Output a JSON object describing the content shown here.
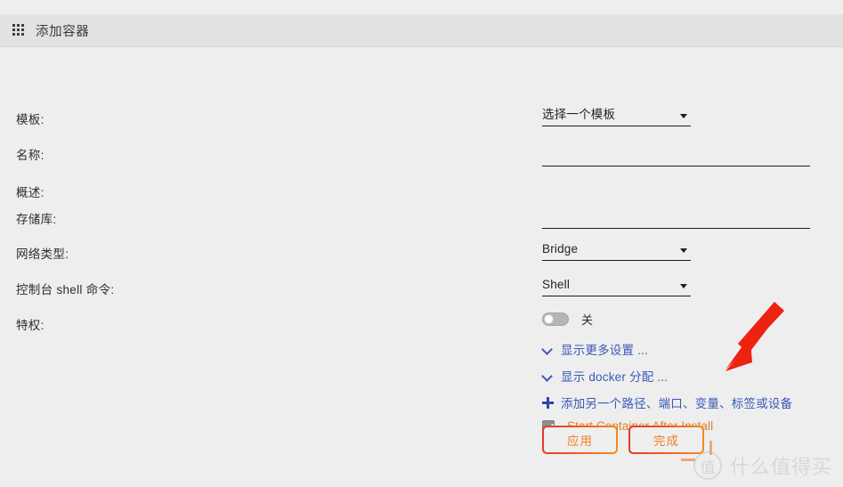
{
  "header": {
    "icon": "grid-apps-icon",
    "title": "添加容器"
  },
  "form": {
    "labels": {
      "template": "模板:",
      "name": "名称:",
      "overview": "概述:",
      "repository": "存储库:",
      "network_type": "网络类型:",
      "console_shell_command": "控制台 shell 命令:",
      "privileged": "特权:"
    },
    "template_select": {
      "value": "选择一个模板",
      "caret": "chevron-down-icon"
    },
    "name_input": {
      "value": "",
      "placeholder": ""
    },
    "overview_input": {
      "value": "",
      "placeholder": ""
    },
    "repository_input": {
      "value": "",
      "placeholder": ""
    },
    "network_select": {
      "value": "Bridge",
      "caret": "chevron-down-icon"
    },
    "shell_select": {
      "value": "Shell",
      "caret": "chevron-down-icon"
    },
    "privileged_toggle": {
      "state": "off",
      "label": "关"
    }
  },
  "links": {
    "show_more_settings": "显示更多设置 ...",
    "show_docker_allocations": "显示 docker 分配 ...",
    "add_another": "添加另一个路径、端口、变量、标签或设备"
  },
  "checkbox": {
    "label": "Start Container After Install",
    "checked": true
  },
  "buttons": {
    "apply": "应用",
    "done": "完成"
  },
  "annotation": {
    "arrow": "red-arrow-annotation",
    "color": "#ee2211"
  },
  "watermark": {
    "logo_char": "值",
    "text": "什么值得买"
  },
  "colors": {
    "page_bg": "#eeeeee",
    "header_bg": "#e2e2e2",
    "link_blue": "#3b58b8",
    "accent_orange": "#ef7f23",
    "checkbox_label_orange": "#e08020"
  }
}
